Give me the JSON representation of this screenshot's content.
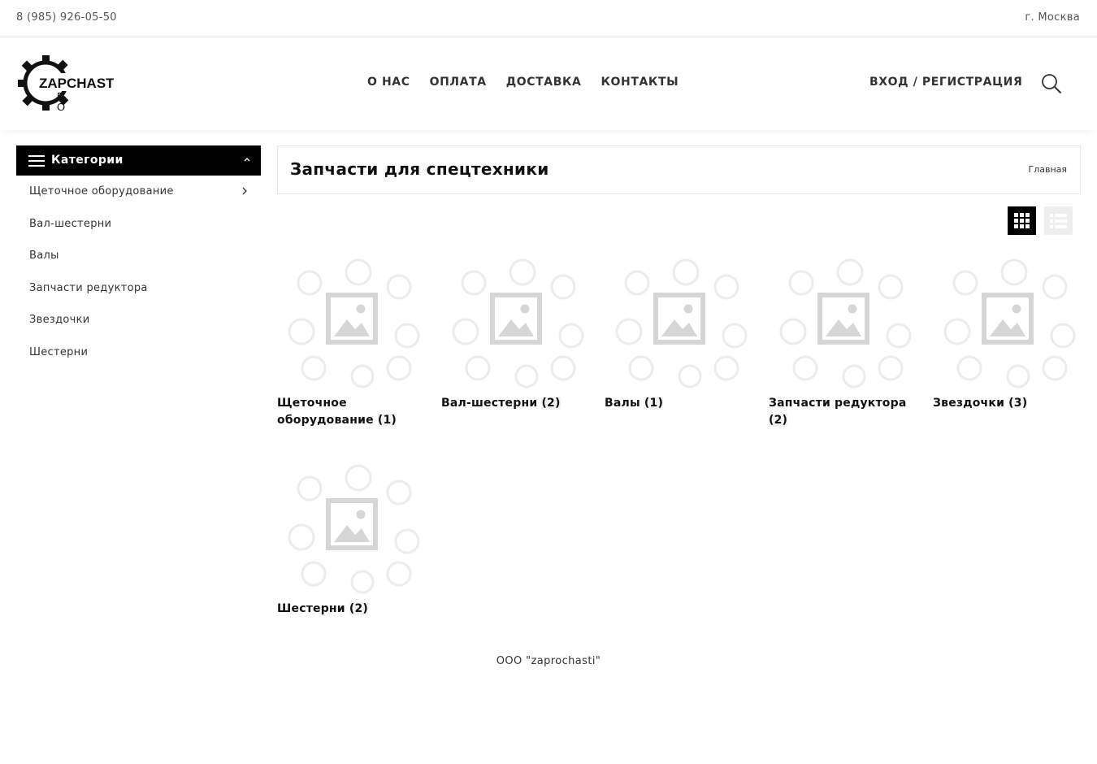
{
  "topbar": {
    "phone": "8 (985) 926-05-50",
    "city": "г. Москва"
  },
  "logo": {
    "text": "ZAPCHASTI",
    "r": "R",
    "o": "O"
  },
  "nav": [
    {
      "label": "О НАС"
    },
    {
      "label": "ОПЛАТА"
    },
    {
      "label": "ДОСТАВКА"
    },
    {
      "label": "КОНТАКТЫ"
    }
  ],
  "account": {
    "login_label": "ВХОД / РЕГИСТРАЦИЯ"
  },
  "sidebar": {
    "title": "Категории",
    "items": [
      {
        "label": "Щеточное оборудование",
        "has_children": true
      },
      {
        "label": "Вал-шестерни"
      },
      {
        "label": "Валы"
      },
      {
        "label": "Запчасти редуктора"
      },
      {
        "label": "Звездочки"
      },
      {
        "label": "Шестерни"
      }
    ]
  },
  "page": {
    "title": "Запчасти для спецтехники",
    "breadcrumb": "Главная"
  },
  "products": [
    {
      "name": "Щеточное оборудование",
      "count": "(1)"
    },
    {
      "name": "Вал-шестерни",
      "count": "(2)"
    },
    {
      "name": "Валы",
      "count": "(1)"
    },
    {
      "name": "Запчасти редуктора",
      "count": "(2)"
    },
    {
      "name": "Звездочки",
      "count": "(3)"
    },
    {
      "name": "Шестерни",
      "count": "(2)"
    }
  ],
  "footer": {
    "text": "ООО \"zaprochasti\""
  }
}
